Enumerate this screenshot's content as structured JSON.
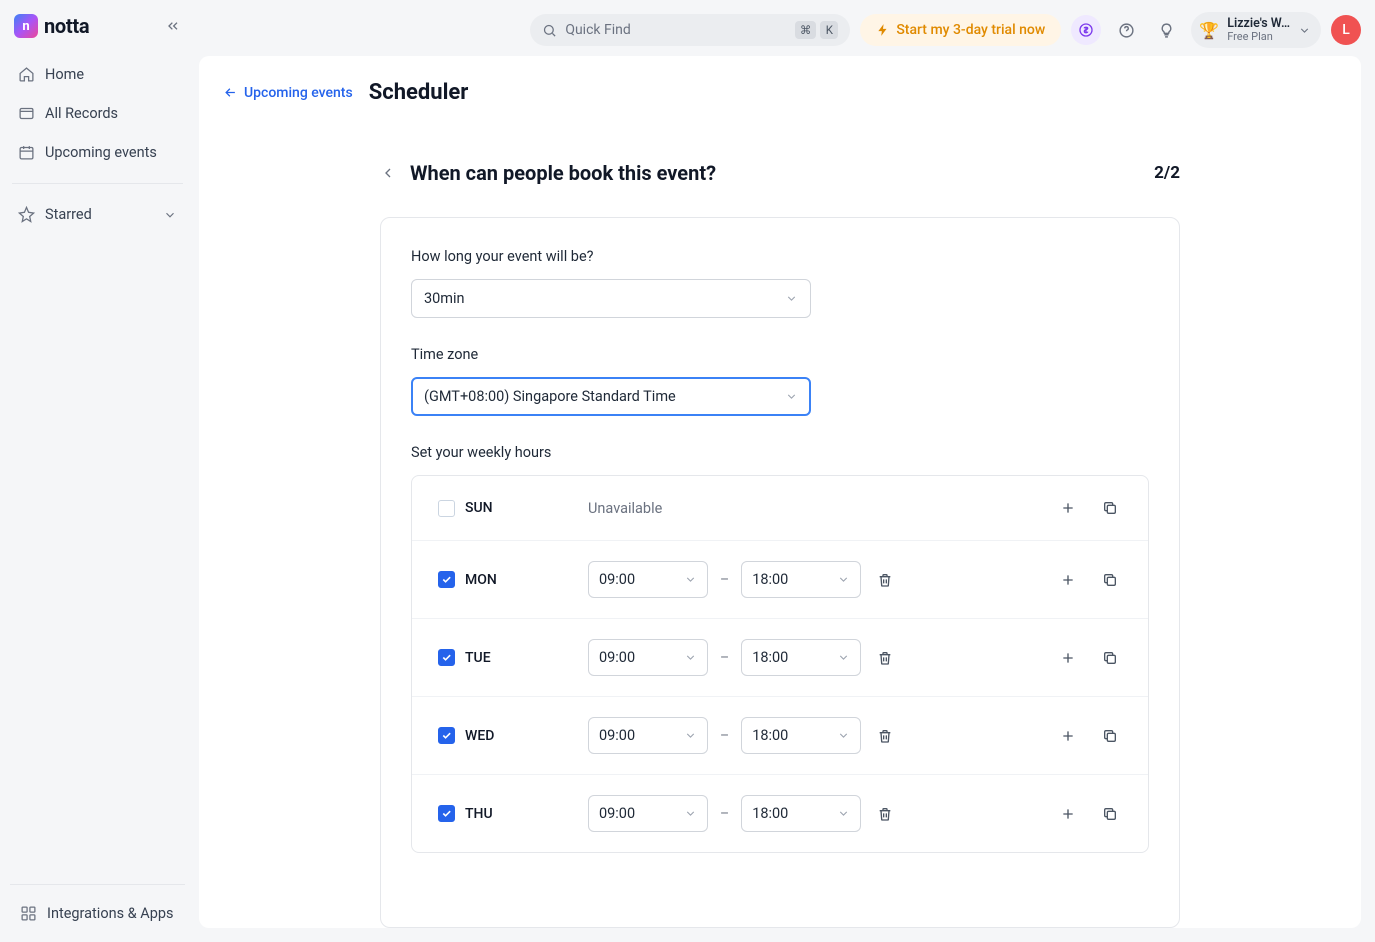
{
  "brand": {
    "name": "notta",
    "mark": "n"
  },
  "sidebar": {
    "items": [
      {
        "label": "Home"
      },
      {
        "label": "All Records"
      },
      {
        "label": "Upcoming events"
      }
    ],
    "starred_label": "Starred",
    "integrations_label": "Integrations & Apps"
  },
  "topbar": {
    "quickfind_placeholder": "Quick Find",
    "kbd_cmd": "⌘",
    "kbd_k": "K",
    "trial_label": "Start my 3-day trial now",
    "workspace_name": "Lizzie's W…",
    "workspace_plan": "Free Plan",
    "avatar_initial": "L"
  },
  "breadcrumb": {
    "back_label": "Upcoming events",
    "page_title": "Scheduler"
  },
  "form": {
    "title": "When can people book this event?",
    "step_indicator": "2/2",
    "duration_label": "How long your event will be?",
    "duration_value": "30min",
    "timezone_label": "Time zone",
    "timezone_value": "(GMT+08:00) Singapore Standard Time",
    "weekly_label": "Set your weekly hours",
    "unavailable_text": "Unavailable",
    "days": [
      {
        "name": "SUN",
        "enabled": false
      },
      {
        "name": "MON",
        "enabled": true,
        "start": "09:00",
        "end": "18:00"
      },
      {
        "name": "TUE",
        "enabled": true,
        "start": "09:00",
        "end": "18:00"
      },
      {
        "name": "WED",
        "enabled": true,
        "start": "09:00",
        "end": "18:00"
      },
      {
        "name": "THU",
        "enabled": true,
        "start": "09:00",
        "end": "18:00"
      }
    ]
  }
}
